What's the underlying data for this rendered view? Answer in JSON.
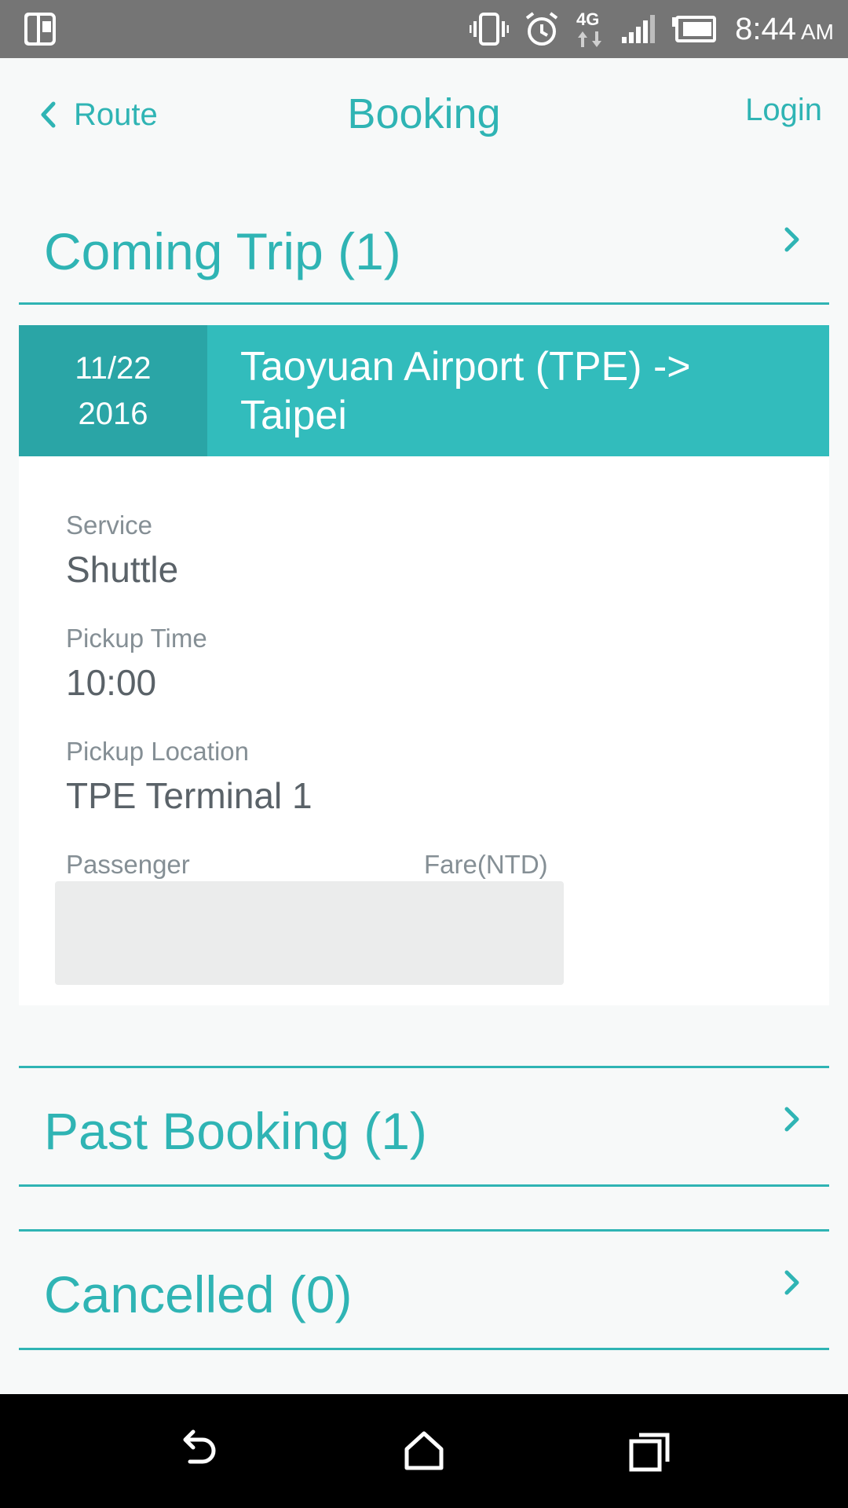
{
  "status_bar": {
    "time": "8:44",
    "ampm": "AM",
    "network": "4G",
    "icons": [
      "screen-mirror-icon",
      "vibrate-icon",
      "alarm-icon",
      "4g-data-icon",
      "signal-icon",
      "battery-icon"
    ]
  },
  "header": {
    "back_label": "Route",
    "title": "Booking",
    "login_label": "Login"
  },
  "sections": {
    "coming_trip": "Coming Trip (1)",
    "past_booking": "Past Booking (1)",
    "cancelled": "Cancelled (0)"
  },
  "trip": {
    "date_line1": "11/22",
    "date_line2": "2016",
    "route": "Taoyuan Airport (TPE) -> Taipei",
    "service_label": "Service",
    "service_value": "Shuttle",
    "pickup_time_label": "Pickup Time",
    "pickup_time_value": "10:00",
    "pickup_location_label": "Pickup Location",
    "pickup_location_value": "TPE Terminal 1",
    "passenger_label": "Passenger",
    "fare_label": "Fare(NTD)"
  },
  "nav_bar": {
    "icons": [
      "back-icon",
      "home-icon",
      "recent-apps-icon"
    ]
  },
  "colors": {
    "accent": "#2fb4b4",
    "trip_header": "#32bcbc",
    "trip_date": "#2aa5a6",
    "status_bar": "#757575",
    "nav_bar": "#000000"
  }
}
